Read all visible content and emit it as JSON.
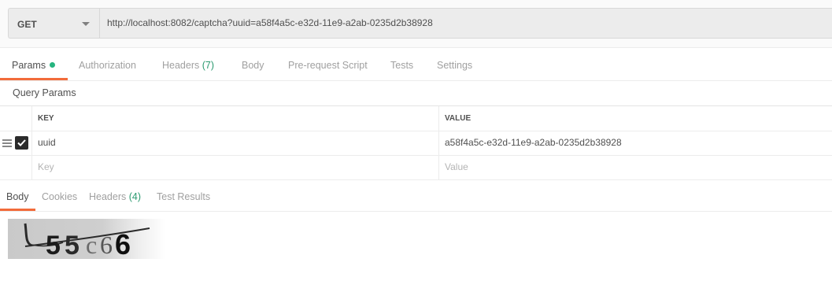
{
  "request": {
    "method": "GET",
    "url": "http://localhost:8082/captcha?uuid=a58f4a5c-e32d-11e9-a2ab-0235d2b38928"
  },
  "request_tabs": [
    {
      "label": "Params"
    },
    {
      "label": "Authorization"
    },
    {
      "label": "Headers",
      "count": "(7)"
    },
    {
      "label": "Body"
    },
    {
      "label": "Pre-request Script"
    },
    {
      "label": "Tests"
    },
    {
      "label": "Settings"
    }
  ],
  "query_params": {
    "title": "Query Params",
    "columns": {
      "key": "KEY",
      "value": "VALUE"
    },
    "rows": [
      {
        "key": "uuid",
        "value": "a58f4a5c-e32d-11e9-a2ab-0235d2b38928",
        "checked": true
      }
    ],
    "new_row": {
      "key_placeholder": "Key",
      "value_placeholder": "Value"
    }
  },
  "response_tabs": [
    {
      "label": "Body"
    },
    {
      "label": "Cookies"
    },
    {
      "label": "Headers",
      "count": "(4)"
    },
    {
      "label": "Test Results"
    }
  ],
  "captcha": {
    "text": "U55c66"
  },
  "colors": {
    "accent": "#f26b3a",
    "status_dot": "#26b47f",
    "count": "#2a9a6f"
  }
}
